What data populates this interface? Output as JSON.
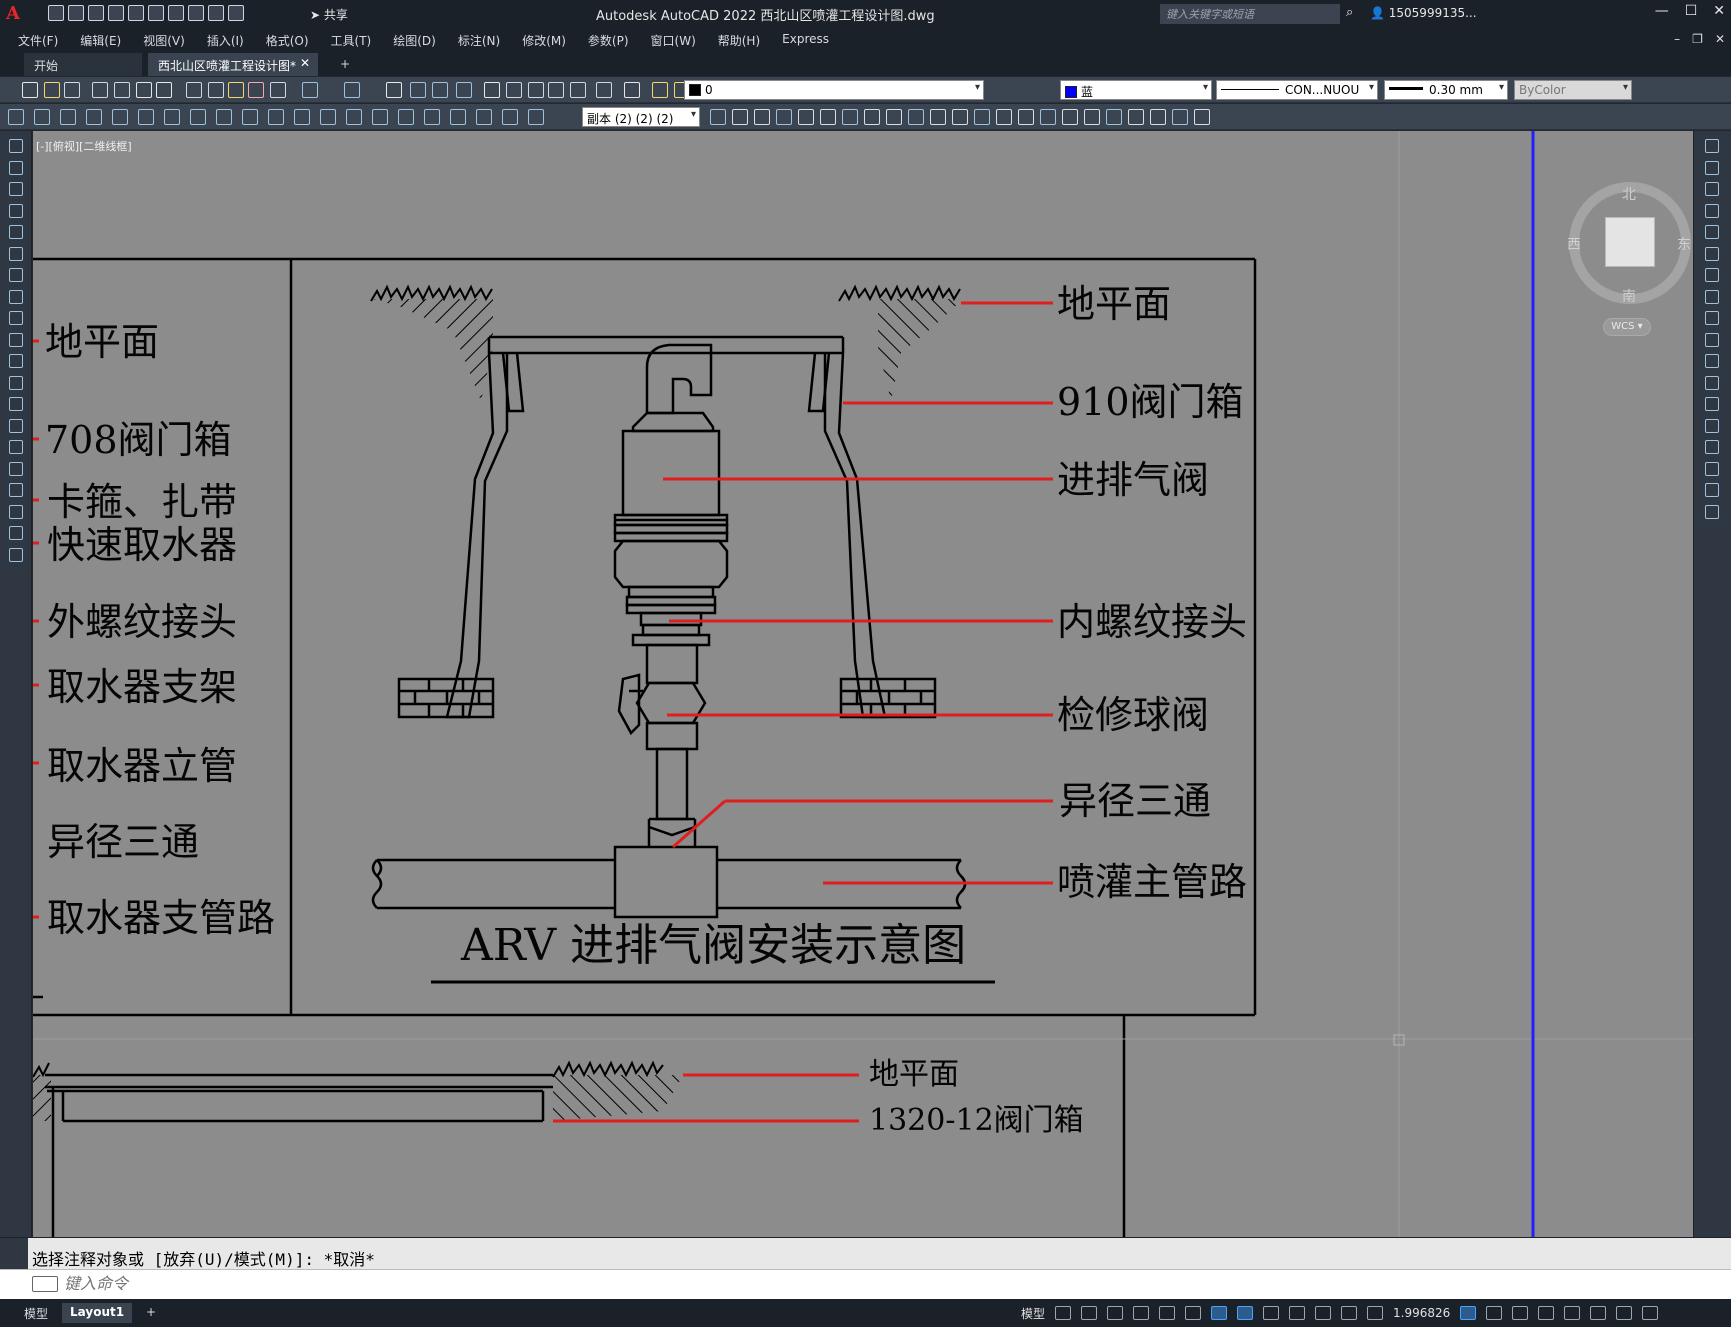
{
  "app": {
    "title": "Autodesk AutoCAD 2022    西北山区喷灌工程设计图.dwg",
    "share_label": "共享",
    "search_placeholder": "键入关键字或短语",
    "user": "1505999135...",
    "colors": {
      "title_bg": "#1b2129",
      "toolbar_bg": "#3b4451",
      "canvas_bg": "#8c8c8c",
      "accent_red": "#e01e1e",
      "ucs_blue": "#1f1fff"
    }
  },
  "menu": {
    "items": [
      "文件(F)",
      "编辑(E)",
      "视图(V)",
      "插入(I)",
      "格式(O)",
      "工具(T)",
      "绘图(D)",
      "标注(N)",
      "修改(M)",
      "参数(P)",
      "窗口(W)",
      "帮助(H)",
      "Express"
    ]
  },
  "tabs": {
    "start": "开始",
    "doc": "西北山区喷灌工程设计图*",
    "add": "+"
  },
  "properties": {
    "layer": "0",
    "color": "蓝",
    "color_hex": "#0000ff",
    "linetype": "CON...NUOU",
    "lineweight": "0.30 mm",
    "plotstyle": "ByColor",
    "annoscale": "副本 (2) (2) (2)"
  },
  "viewport": {
    "label": "[-][俯视][二维线框]"
  },
  "viewcube": {
    "north": "北",
    "south": "南",
    "east": "东",
    "west": "西",
    "wcs": "WCS"
  },
  "drawing": {
    "title": "ARV 进排气阀安装示意图",
    "left_labels": [
      "地平面",
      "708阀门箱",
      "卡箍、扎带",
      "快速取水器",
      "外螺纹接头",
      "取水器支架",
      "取水器立管",
      "异径三通",
      "取水器支管路"
    ],
    "right_labels": [
      "地平面",
      "910阀门箱",
      "进排气阀",
      "内螺纹接头",
      "检修球阀",
      "异径三通",
      "喷灌主管路"
    ],
    "bottom_labels": [
      "地平面",
      "1320-12阀门箱"
    ]
  },
  "command": {
    "history": "选择注释对象或 [放弃(U)/模式(M)]: *取消*",
    "placeholder": "键入命令"
  },
  "status": {
    "model_tab": "模型",
    "layout_tab": "Layout1",
    "add_tab": "+",
    "model_space": "模型",
    "scale": "1.996826"
  }
}
